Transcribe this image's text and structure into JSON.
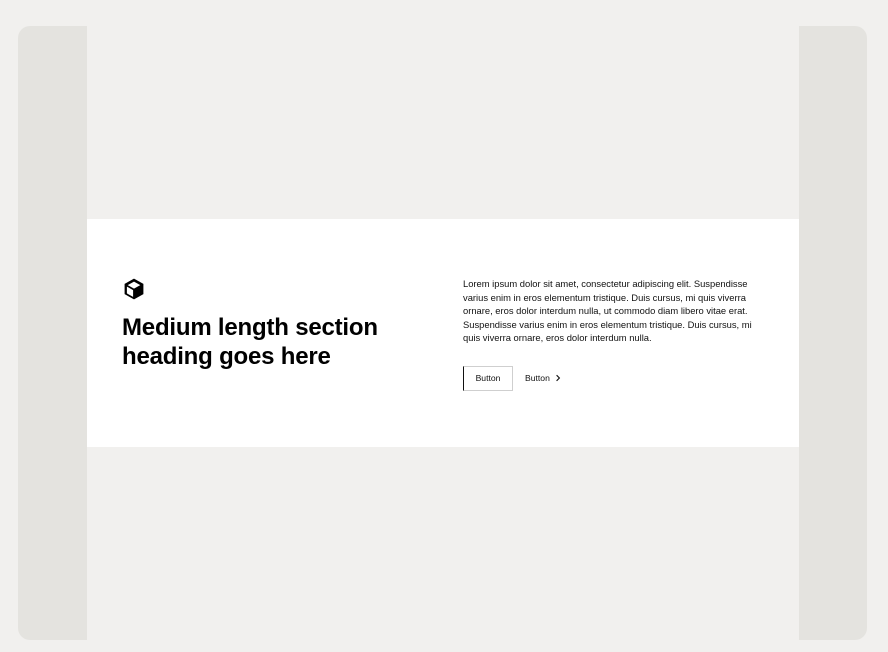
{
  "section": {
    "icon": "cube-icon",
    "heading": "Medium length section heading goes here",
    "body": "Lorem ipsum dolor sit amet, consectetur adipiscing elit. Suspendisse varius enim in eros elementum tristique. Duis cursus, mi quis viverra ornare, eros dolor interdum nulla, ut commodo diam libero vitae erat. Suspendisse varius enim in eros elementum tristique. Duis cursus, mi quis viverra ornare, eros dolor interdum nulla.",
    "primary_button_label": "Button",
    "link_button_label": "Button",
    "link_button_icon": "chevron-right-icon"
  },
  "colors": {
    "page_background": "#f1f0ee",
    "frame_background": "#e4e3df",
    "section_background": "#ffffff",
    "text": "#000000"
  }
}
